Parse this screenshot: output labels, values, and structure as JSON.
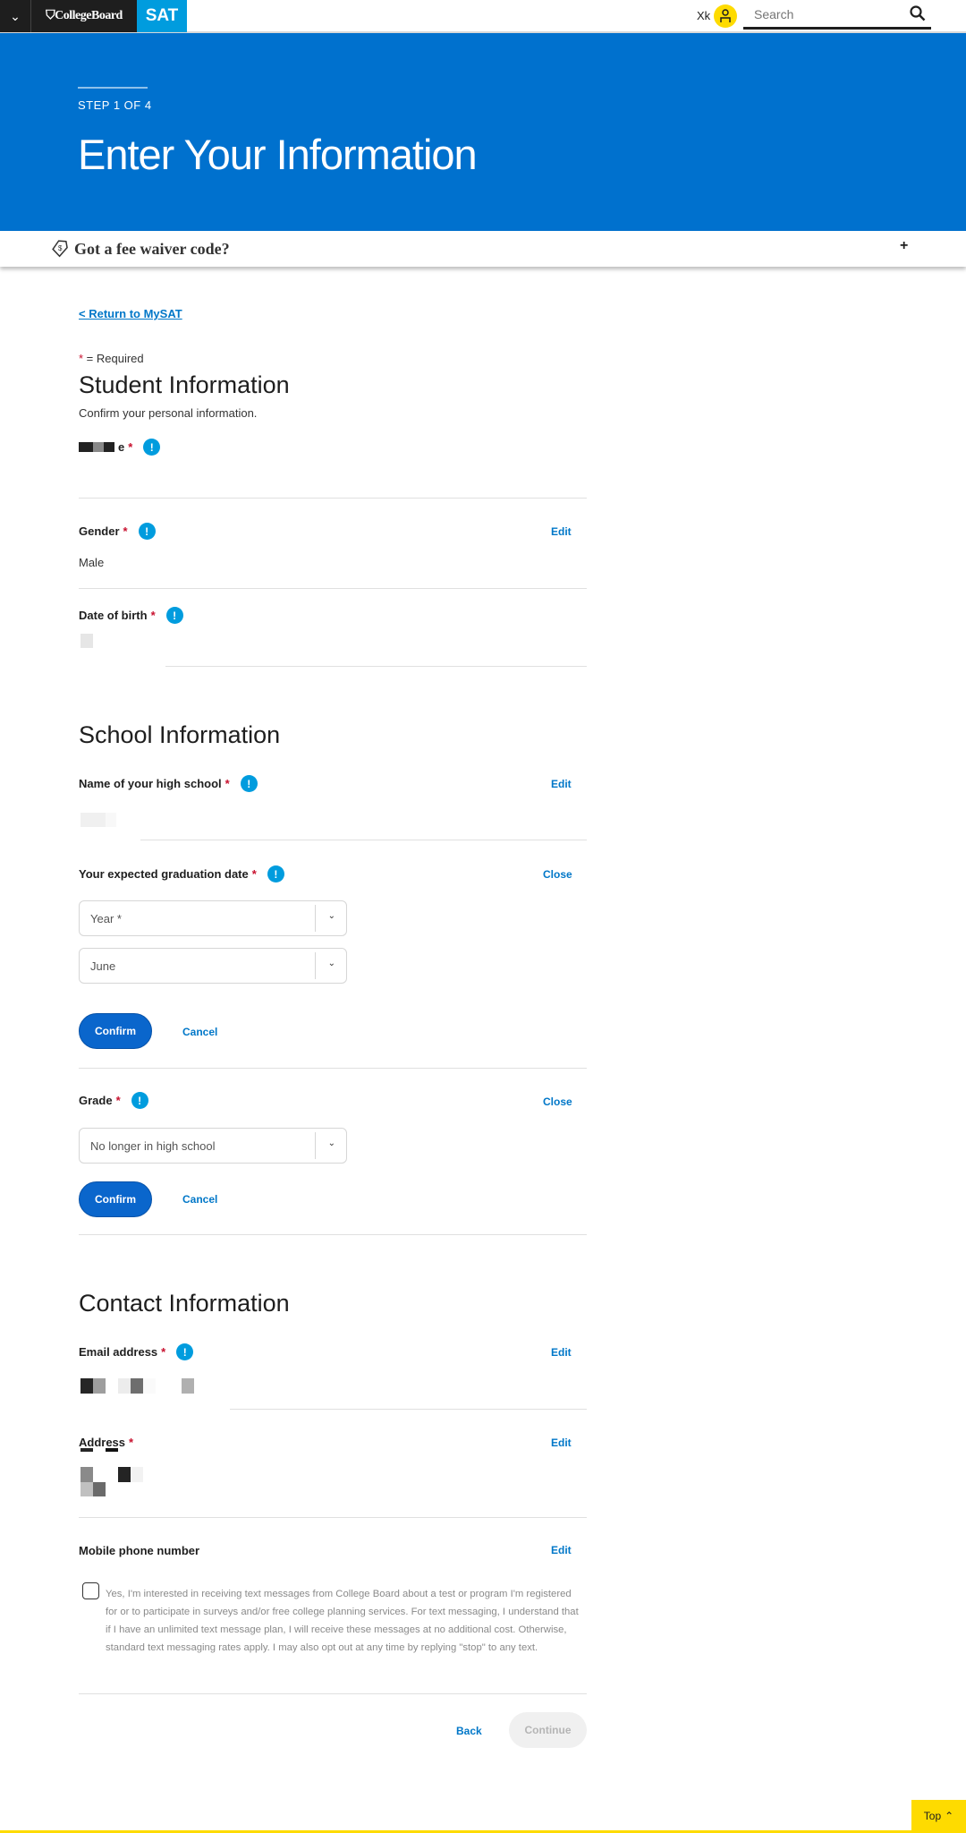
{
  "header": {
    "brand": "CollegeBoard",
    "product": "SAT",
    "user_initials": "Xk",
    "search_placeholder": "Search"
  },
  "hero": {
    "step": "STEP 1 OF 4",
    "title": "Enter Your Information"
  },
  "fee_waiver": {
    "label": "Got a fee waiver code?",
    "expand": "+"
  },
  "return_link": "< Return to MySAT",
  "required_note": {
    "star": "*",
    "text": " = Required"
  },
  "student": {
    "heading": "Student Information",
    "subtitle": "Confirm your personal information.",
    "name_label_fragment": "e",
    "gender_label": "Gender",
    "gender_value": "Male",
    "dob_label": "Date of birth",
    "edit": "Edit"
  },
  "school": {
    "heading": "School Information",
    "hs_label": "Name of your high school",
    "grad_label": "Your expected graduation date",
    "year_select": "Year *",
    "month_select": "June",
    "grade_label": "Grade",
    "grade_select": "No longer in high school",
    "edit": "Edit",
    "close": "Close",
    "confirm": "Confirm",
    "cancel": "Cancel"
  },
  "contact": {
    "heading": "Contact Information",
    "email_label": "Email address",
    "address_label": "Address",
    "mobile_label": "Mobile phone number",
    "edit": "Edit",
    "consent_checked": false,
    "consent_text": "Yes, I'm interested in receiving text messages from College Board about a test or program I'm registered for or to participate in surveys and/or free college planning services. For text messaging, I understand that if I have an unlimited text message plan, I will receive these messages at no additional cost. Otherwise, standard text messaging rates apply. I may also opt out at any time by replying \"stop\" to any text."
  },
  "footer": {
    "back": "Back",
    "continue": "Continue",
    "top": "Top"
  },
  "colors": {
    "brand_blue": "#0071ce",
    "sat_blue": "#009cde",
    "accent_yellow": "#fedb00",
    "required_red": "#c8102e"
  }
}
